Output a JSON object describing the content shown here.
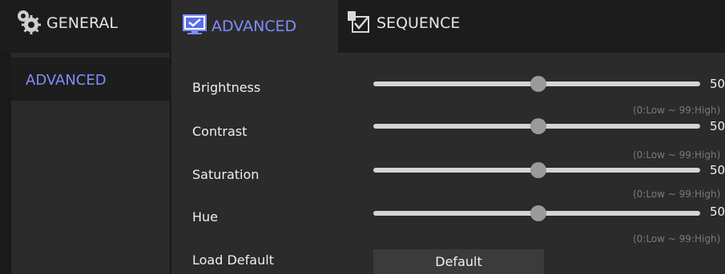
{
  "tabs": [
    {
      "label": "GENERAL",
      "icon": "gear-icon",
      "active": false
    },
    {
      "label": "ADVANCED",
      "icon": "monitor-check-icon",
      "active": true
    },
    {
      "label": "SEQUENCE",
      "icon": "sequence-icon",
      "active": false
    }
  ],
  "sidebar": {
    "items": [
      {
        "label": "ADVANCED",
        "active": true
      }
    ]
  },
  "settings": {
    "brightness": {
      "label": "Brightness",
      "value": "50",
      "hint": "(0:Low ~ 99:High)"
    },
    "contrast": {
      "label": "Contrast",
      "value": "50",
      "hint": "(0:Low ~ 99:High)"
    },
    "saturation": {
      "label": "Saturation",
      "value": "50",
      "hint": "(0:Low ~ 99:High)"
    },
    "hue": {
      "label": "Hue",
      "value": "50",
      "hint": "(0:Low ~ 99:High)"
    }
  },
  "load_default": {
    "label": "Load Default",
    "button_label": "Default"
  },
  "colors": {
    "accent": "#7f8cff",
    "panel": "#2b2b2b",
    "background": "#1a1a1a"
  }
}
